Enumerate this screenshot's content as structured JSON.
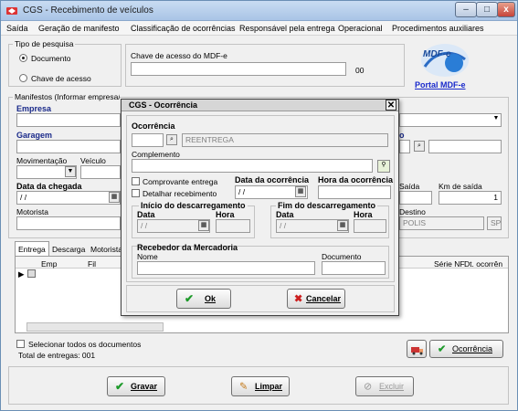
{
  "window": {
    "title": "CGS - Recebimento de veículos",
    "minimize": "–",
    "maximize": "□",
    "close": "x"
  },
  "menu": [
    "Saída",
    "Geração de manifesto",
    "Classificação de ocorrências",
    "Responsável pela entrega",
    "Operacional",
    "Procedimentos auxiliares"
  ],
  "search_type": {
    "label": "Tipo de pesquisa",
    "options": [
      "Documento",
      "Chave de acesso"
    ],
    "selected": "Documento"
  },
  "mdfe": {
    "key_label": "Chave de acesso do MDF-e",
    "count": "00",
    "logo_text": "MDF-e",
    "portal_link": "Portal MDF-e"
  },
  "manifests": {
    "label": "Manifestos (Informar empresa/filial/garagem do local onde está sendo executado o recebimento)",
    "empresa_label": "Empresa",
    "garagem_label": "Garagem",
    "movimentacao_label": "Movimentação",
    "veiculo_label": "Veículo",
    "data_chegada_label": "Data da chegada",
    "data_chegada_value": "  /  /",
    "saida_label": "Saída",
    "km_saida_label": "Km de saída",
    "km_saida_value": "1",
    "motorista_label": "Motorista",
    "destino_label": "Destino",
    "destino_value": "POLIS",
    "uf_value": "SP",
    "garagem_code_label": "o"
  },
  "tabs": [
    "Entrega",
    "Descarga",
    "Motorista"
  ],
  "grid": {
    "columns": [
      "Emp",
      "Fil",
      "Série NF",
      "Dt. ocorrên"
    ],
    "selected_row_indicator": "▶"
  },
  "footer": {
    "select_all_label": "Selecionar todos os documentos",
    "total_label": "Total de entregas: 001",
    "ocorrencia_button": "Ocorrência"
  },
  "bottom_buttons": {
    "save": "Gravar",
    "clear": "Limpar",
    "delete": "Excluir"
  },
  "dialog": {
    "title": "CGS - Ocorrência",
    "ocorrencia_label": "Ocorrência",
    "ocorrencia_desc": "REENTREGA",
    "complemento_label": "Complemento",
    "comprovante_label": "Comprovante entrega",
    "detalhar_label": "Detalhar recebimento",
    "data_ocorrencia_label": "Data da ocorrência",
    "data_ocorrencia_value": "  /  /",
    "hora_ocorrencia_label": "Hora da ocorrência",
    "inicio_label": "Início  do descarregamento",
    "fim_label": "Fim do descarregamento",
    "data_label": "Data",
    "hora_label": "Hora",
    "inicio_data_value": "  /  /",
    "fim_data_value": "  /  /",
    "recebedor_label": "Recebedor da Mercadoria",
    "nome_label": "Nome",
    "documento_label": "Documento",
    "ok": "Ok",
    "cancel": "Cancelar"
  },
  "colors": {
    "title_bar": "#b9d1ee",
    "label_navy": "#1a2a8a",
    "ok_check": "#1d9a2a",
    "cancel_x": "#cc1f1f",
    "portal_link": "#1a2acc"
  }
}
